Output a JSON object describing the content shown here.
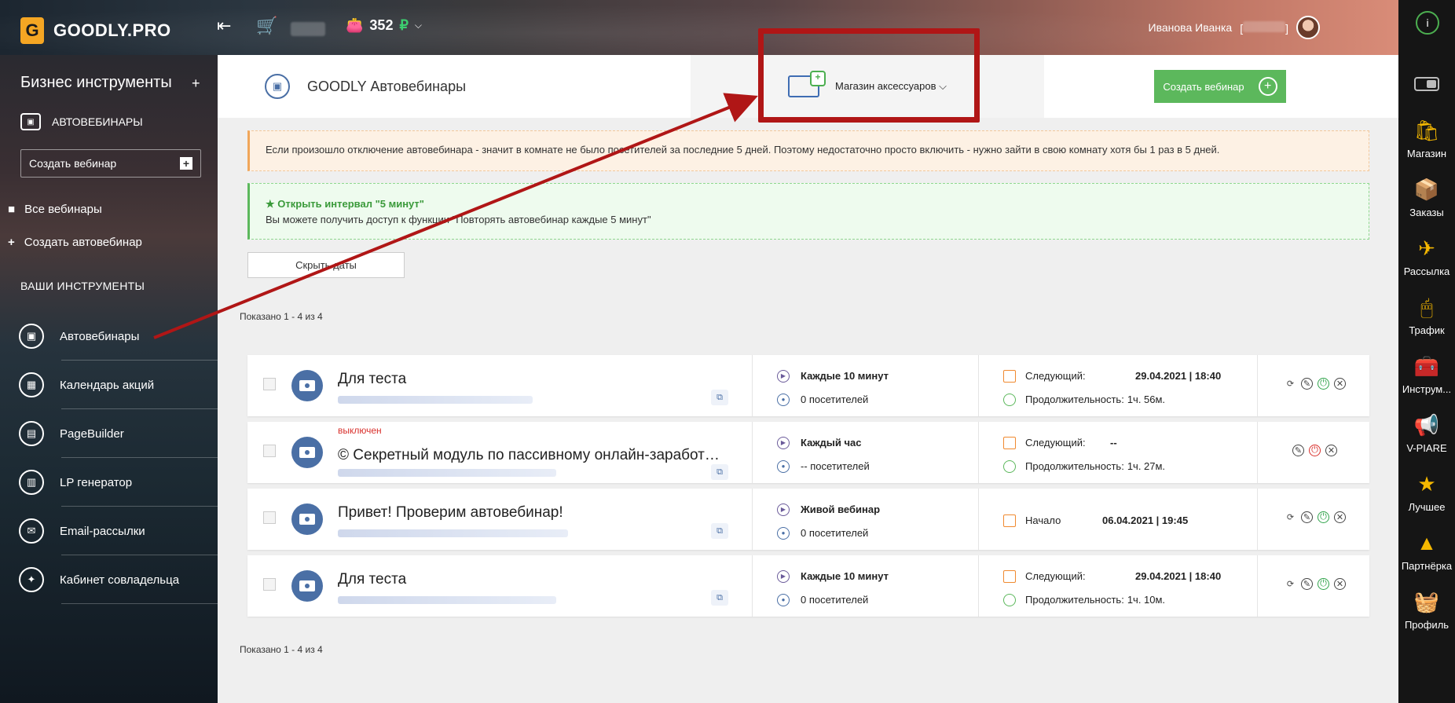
{
  "app": {
    "logo_letter": "G",
    "logo_text": "GOODLY.PRO"
  },
  "topbar": {
    "balance": "352",
    "currency": "₽",
    "user_name": "Иванова Иванка",
    "user_id_bracket": "[",
    "user_id_bracket_close": "]"
  },
  "sidebar": {
    "title": "Бизнес инструменты",
    "category": "АВТОВЕБИНАРЫ",
    "create_label": "Создать вебинар",
    "links": [
      {
        "label": "Все вебинары",
        "icon": "video-icon"
      },
      {
        "label": "Создать автовебинар",
        "icon": "plus-icon"
      }
    ],
    "section": "ВАШИ ИНСТРУМЕНТЫ",
    "tools": [
      {
        "label": "Автовебинары",
        "icon": "webinar-icon"
      },
      {
        "label": "Календарь акций",
        "icon": "calendar-icon"
      },
      {
        "label": "PageBuilder",
        "icon": "pagebuilder-icon"
      },
      {
        "label": "LP генератор",
        "icon": "lp-icon"
      },
      {
        "label": "Email-рассылки",
        "icon": "mail-icon"
      },
      {
        "label": "Кабинет совладельца",
        "icon": "handshake-icon"
      }
    ]
  },
  "rightbar": {
    "items": [
      {
        "label": "Магазин",
        "icon": "shop-bag-icon"
      },
      {
        "label": "Заказы",
        "icon": "orders-icon"
      },
      {
        "label": "Рассылка",
        "icon": "paper-plane-icon"
      },
      {
        "label": "Трафик",
        "icon": "traffic-icon"
      },
      {
        "label": "Инструм...",
        "icon": "toolbox-icon"
      },
      {
        "label": "V-PIARE",
        "icon": "megaphone-icon"
      },
      {
        "label": "Лучшее",
        "icon": "best-icon"
      },
      {
        "label": "Партнёрка",
        "icon": "partner-icon"
      },
      {
        "label": "Профиль",
        "icon": "profile-basket-icon"
      }
    ]
  },
  "header": {
    "title": "GOODLY Автовебинары",
    "shop_dropdown": "Магазин аксессуаров",
    "create_button": "Создать вебинар"
  },
  "alerts": {
    "warning": "Если произошло отключение автовебинара - значит в комнате не было посетителей за последние 5 дней. Поэтому недостаточно просто включить - нужно зайти в свою комнату хотя бы 1 раз в 5 дней.",
    "promo_title": "Открыть интервал \"5 минут\"",
    "promo_text": "Вы можете получить доступ к функции \"Повторять автовебинар каждые 5 минут\""
  },
  "hide_dates_button": "Скрыть даты",
  "shown_text": "Показано 1 - 4 из 4",
  "webinars": [
    {
      "title": "Для теста",
      "status": "",
      "schedule": "Каждые 10 минут",
      "visitors": "0 посетителей",
      "next_label": "Следующий:",
      "next_value": "29.04.2021 | 18:40",
      "duration_label": "Продолжительность:",
      "duration_value": "1ч. 56м."
    },
    {
      "title": "©  Секретный модуль по пассивному онлайн-заработ…",
      "status": "выключен",
      "schedule": "Каждый час",
      "visitors": "-- посетителей",
      "next_label": "Следующий:",
      "next_value": "--",
      "duration_label": "Продолжительность:",
      "duration_value": "1ч. 27м."
    },
    {
      "title": "Привет! Проверим автовебинар!",
      "status": "",
      "schedule": "Живой вебинар",
      "visitors": "0 посетителей",
      "next_label": "Начало",
      "next_value": "06.04.2021 | 19:45",
      "duration_label": "",
      "duration_value": ""
    },
    {
      "title": "Для теста",
      "status": "",
      "schedule": "Каждые 10 минут",
      "visitors": "0 посетителей",
      "next_label": "Следующий:",
      "next_value": "29.04.2021 | 18:40",
      "duration_label": "Продолжительность:",
      "duration_value": "1ч. 10м."
    }
  ],
  "colors": {
    "accent_green": "#5cb85c",
    "highlight_red": "#b01616",
    "brand_orange": "#f5a623",
    "icon_blue": "#4a6fa5"
  }
}
